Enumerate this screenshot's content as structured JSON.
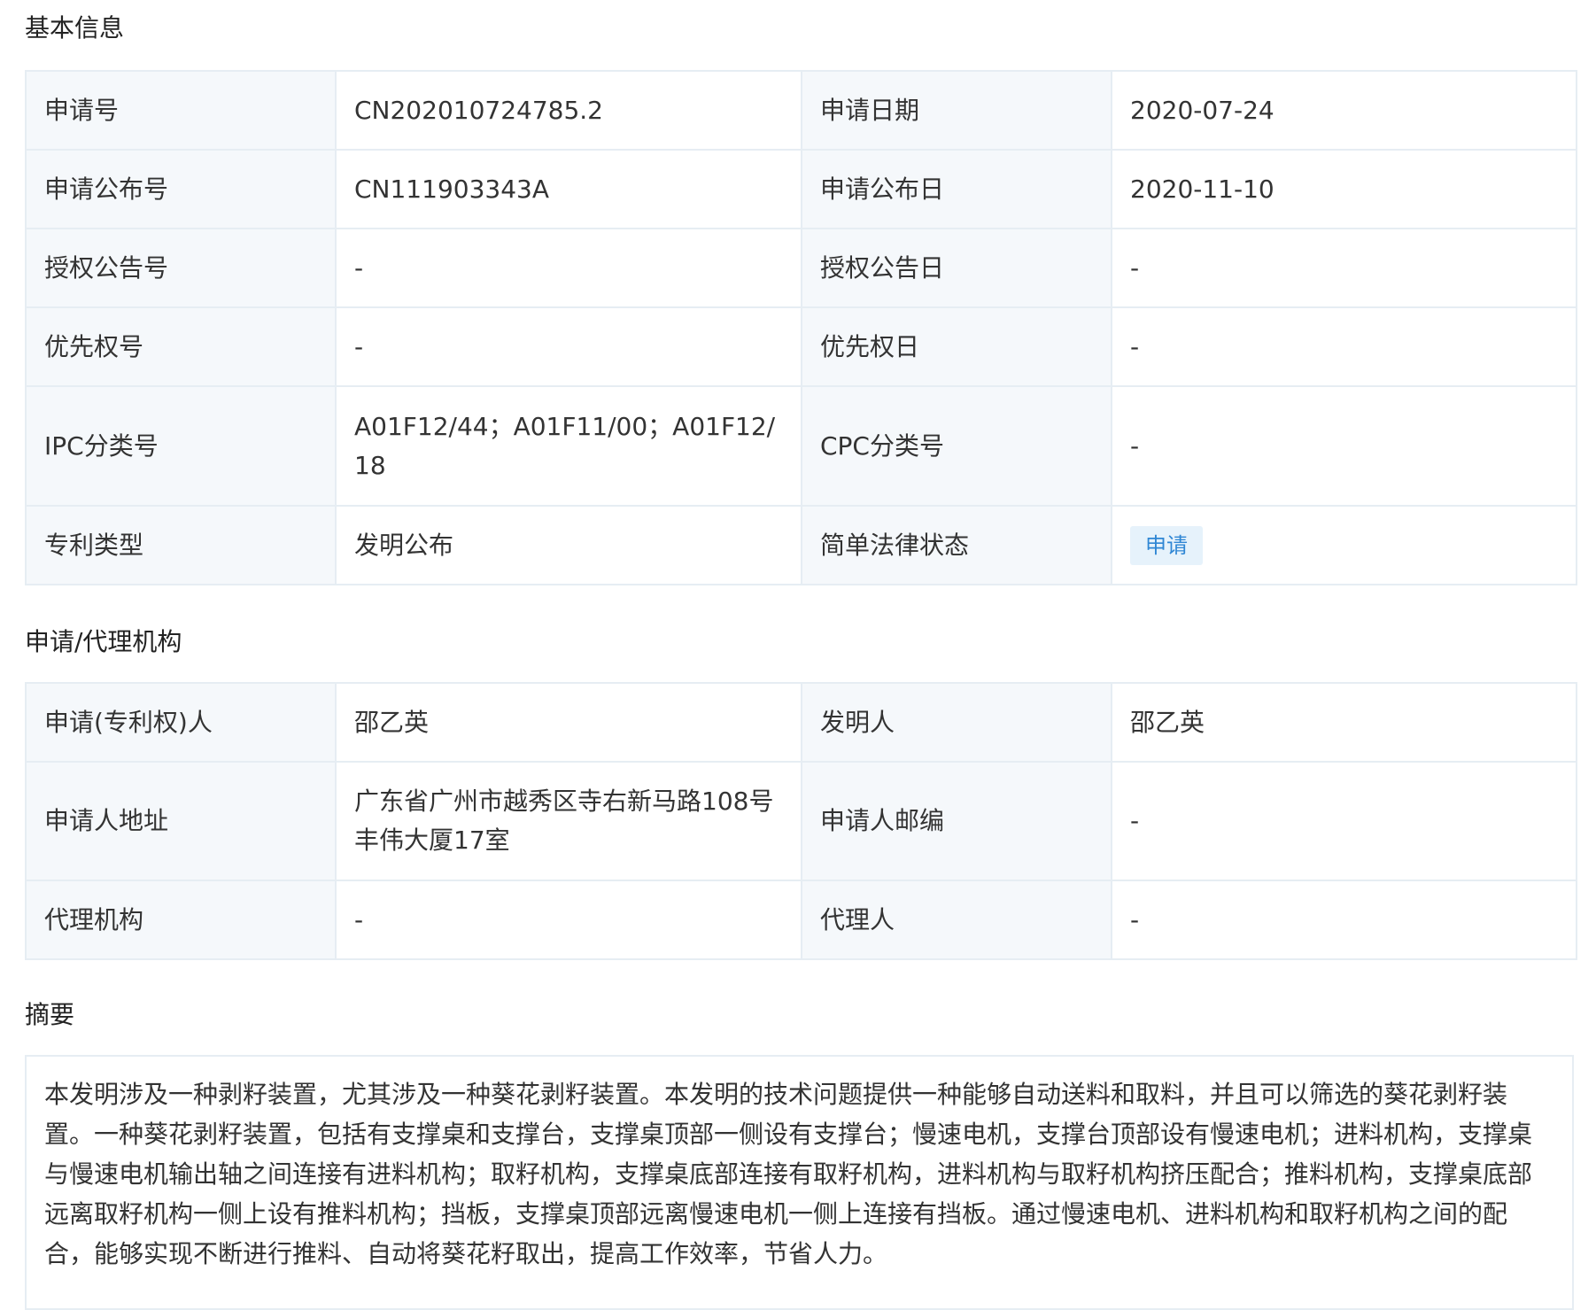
{
  "sections": {
    "basic_title": "基本信息",
    "agency_title": "申请/代理机构",
    "abstract_title": "摘要"
  },
  "basic": {
    "rows": [
      {
        "l1": "申请号",
        "v1": "CN202010724785.2",
        "l2": "申请日期",
        "v2": "2020-07-24"
      },
      {
        "l1": "申请公布号",
        "v1": "CN111903343A",
        "l2": "申请公布日",
        "v2": "2020-11-10"
      },
      {
        "l1": "授权公告号",
        "v1": "-",
        "l2": "授权公告日",
        "v2": "-"
      },
      {
        "l1": "优先权号",
        "v1": "-",
        "l2": "优先权日",
        "v2": "-"
      },
      {
        "l1": "IPC分类号",
        "v1": "A01F12/44；A01F11/00；A01F12/18",
        "l2": "CPC分类号",
        "v2": "-"
      },
      {
        "l1": "专利类型",
        "v1": "发明公布",
        "l2": "简单法律状态",
        "v2": "申请"
      }
    ],
    "status_color": "#2f86d4"
  },
  "agency": {
    "rows": [
      {
        "l1": "申请(专利权)人",
        "v1": "邵乙英",
        "l2": "发明人",
        "v2": "邵乙英"
      },
      {
        "l1": "申请人地址",
        "v1": "广东省广州市越秀区寺右新马路108号丰伟大厦17室",
        "l2": "申请人邮编",
        "v2": "-"
      },
      {
        "l1": "代理机构",
        "v1": "-",
        "l2": "代理人",
        "v2": "-"
      }
    ]
  },
  "abstract": {
    "text": "本发明涉及一种剥籽装置，尤其涉及一种葵花剥籽装置。本发明的技术问题提供一种能够自动送料和取料，并且可以筛选的葵花剥籽装置。一种葵花剥籽装置，包括有支撑桌和支撑台，支撑桌顶部一侧设有支撑台；慢速电机，支撑台顶部设有慢速电机；进料机构，支撑桌与慢速电机输出轴之间连接有进料机构；取籽机构，支撑桌底部连接有取籽机构，进料机构与取籽机构挤压配合；推料机构，支撑桌底部远离取籽机构一侧上设有推料机构；挡板，支撑桌顶部远离慢速电机一侧上连接有挡板。通过慢速电机、进料机构和取籽机构之间的配合，能够实现不断进行推料、自动将葵花籽取出，提高工作效率，节省人力。"
  }
}
